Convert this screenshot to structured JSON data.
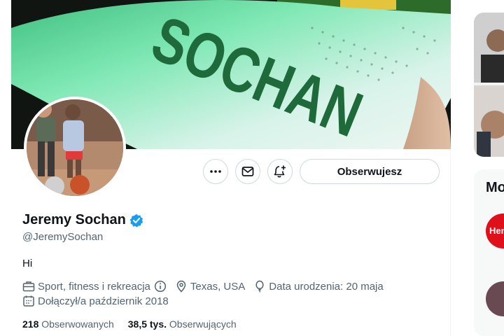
{
  "banner": {
    "jersey_text": "SOCHAN"
  },
  "profile": {
    "name": "Jeremy Sochan",
    "handle": "@JeremySochan",
    "bio": "Hi",
    "category": "Sport, fitness i rekreacja",
    "location": "Texas, USA",
    "birthday": "Data urodzenia: 20 maja",
    "joined": "Dołączył/a październik 2018",
    "following_count": "218",
    "following_label": "Obserwowanych",
    "followers_count": "38,5 tys.",
    "followers_label": "Obserwujących"
  },
  "actions": {
    "follow_label": "Obserwujesz",
    "icons": [
      "more-icon",
      "message-icon",
      "notification-add-icon"
    ]
  },
  "sidebar": {
    "section_title": "Mo",
    "avatar1_text": "Hen"
  },
  "colors": {
    "verified": "#1d9bf0",
    "text_secondary": "#536471",
    "border": "#cfd9de"
  }
}
